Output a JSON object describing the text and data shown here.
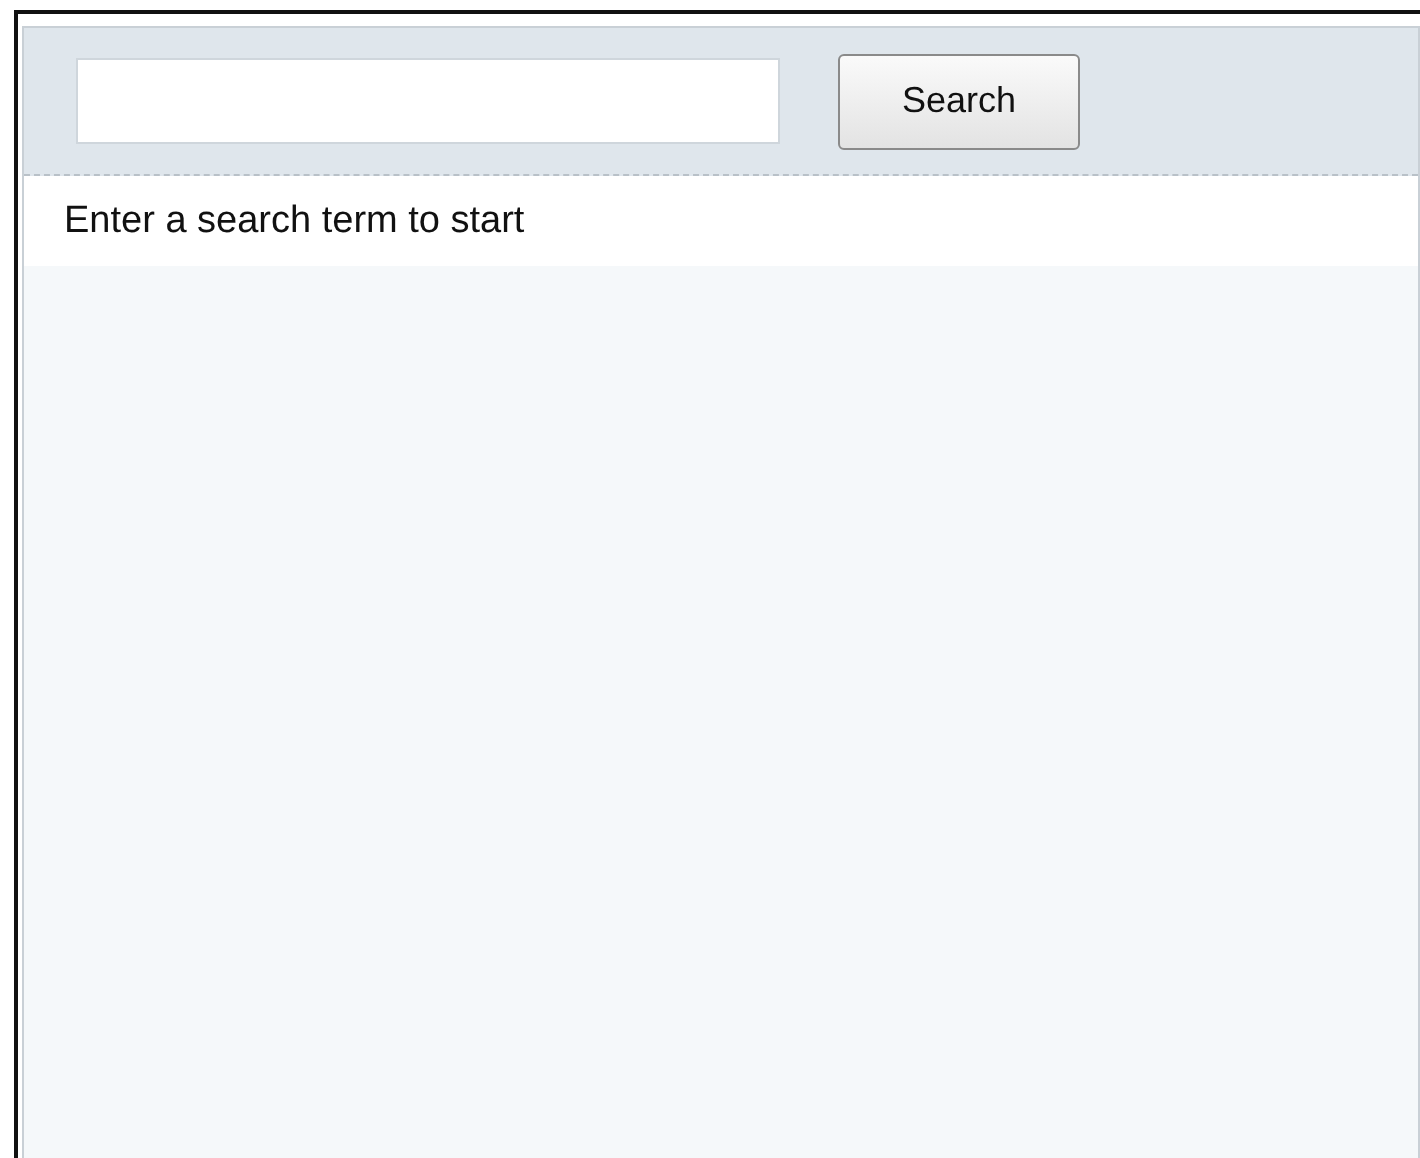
{
  "search": {
    "button": "Search"
  },
  "message": "Enter a search term to start"
}
